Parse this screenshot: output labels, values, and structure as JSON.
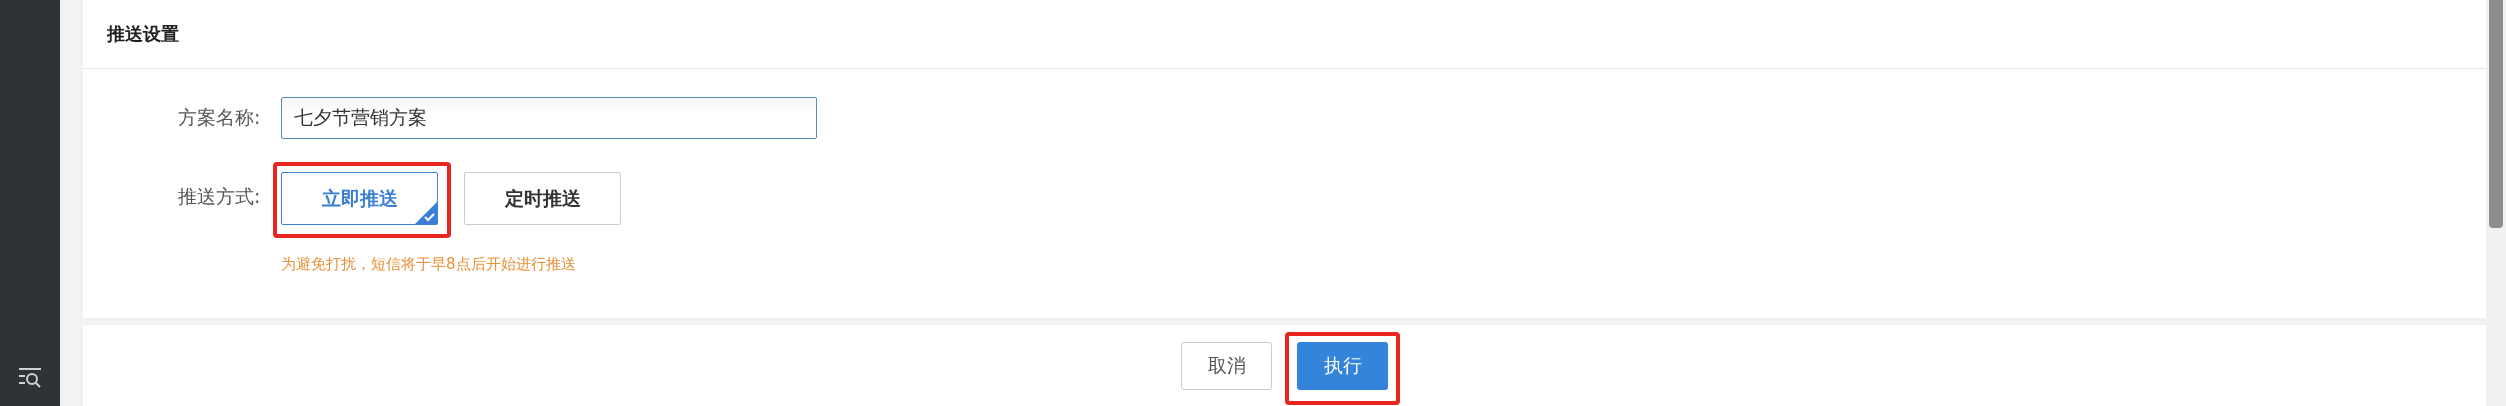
{
  "panel": {
    "title": "推送设置"
  },
  "form": {
    "name_field": {
      "label": "方案名称:",
      "value": "七夕节营销方案"
    },
    "push_mode": {
      "label": "推送方式:",
      "options": [
        {
          "label": "立即推送",
          "selected": true,
          "highlighted": true
        },
        {
          "label": "定时推送",
          "selected": false,
          "highlighted": false
        }
      ]
    },
    "hint": "为避免打扰，短信将于早8点后开始进行推送"
  },
  "footer": {
    "buttons": [
      {
        "label": "取消",
        "kind": "secondary",
        "highlighted": false
      },
      {
        "label": "执行",
        "kind": "primary",
        "highlighted": true
      }
    ]
  }
}
